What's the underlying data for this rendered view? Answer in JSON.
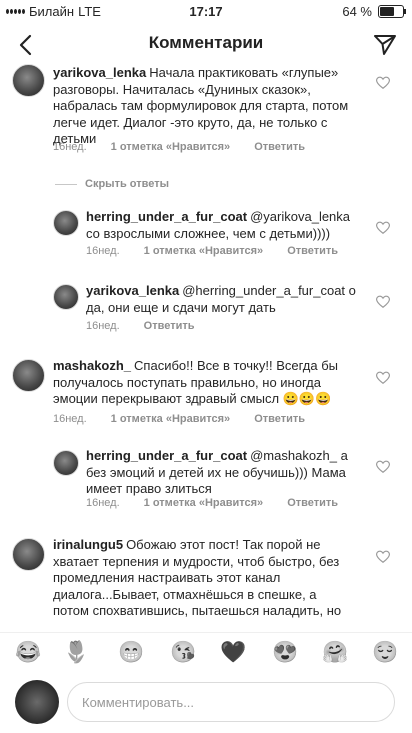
{
  "status_bar": {
    "carrier": "Билайн",
    "network": "LTE",
    "time": "17:17",
    "battery": "64 %"
  },
  "header": {
    "title": "Комментарии"
  },
  "comments": [
    {
      "username": "yarikova_lenka",
      "text": "Начала практиковать «глупые» разговоры. Начиталась «Дуниных сказок», набралась там формулировок для старта, потом легче идет. Диалог -это круто, да, не только с детьми",
      "time": "16нед.",
      "likes": "1 отметка «Нравится»",
      "reply": "Ответить"
    },
    {
      "hide_replies": "Скрыть ответы"
    },
    {
      "username": "herring_under_a_fur_coat",
      "text": "@yarikova_lenka со взрослыми сложнее, чем с детьми))))",
      "time": "16нед.",
      "likes": "1 отметка «Нравится»",
      "reply": "Ответить"
    },
    {
      "username": "yarikova_lenka",
      "text": "@herring_under_a_fur_coat о да, они еще и сдачи могут дать",
      "time": "16нед.",
      "reply": "Ответить"
    },
    {
      "username": "mashakozh_",
      "text": "Спасибо!! Все в точку!! Всегда бы получалось поступать правильно,  но иногда эмоции перекрывают здравый смысл 😀😀😀",
      "time": "16нед.",
      "likes": "1 отметка «Нравится»",
      "reply": "Ответить"
    },
    {
      "username": "herring_under_a_fur_coat",
      "text": "@mashakozh_ а без эмоций и детей их не обучишь))) Мама имеет право злиться",
      "time": "16нед.",
      "likes": "1 отметка «Нравится»",
      "reply": "Ответить"
    },
    {
      "username": "irinalungu5",
      "text": "Обожаю этот пост! Так порой не хватает терпения и мудрости, чтоб быстро, без промедления настраивать этот канал диалога...Бывает, отмахнёшься в спешке, а потом спохватившись, пытаешься наладить, но момент упущен..."
    }
  ],
  "emoji_bar": [
    "😂",
    "🌷",
    "😁",
    "😘",
    "🖤",
    "😍",
    "🤗",
    "😌"
  ],
  "composer": {
    "placeholder": "Комментировать..."
  }
}
